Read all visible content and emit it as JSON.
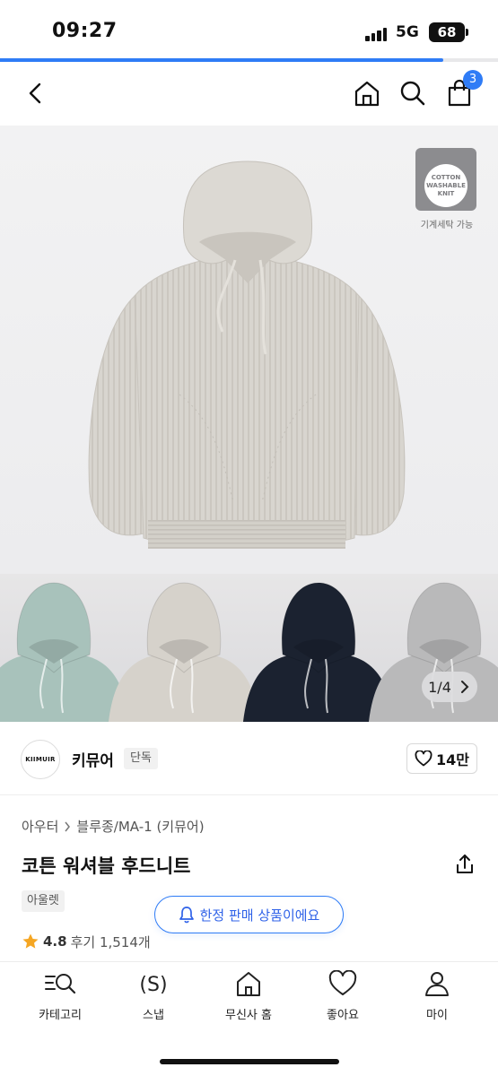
{
  "status_bar": {
    "time": "09:27",
    "network": "5G",
    "battery": "68"
  },
  "page_progress": 0.89,
  "top_nav": {
    "back_icon": "chevron-left-icon",
    "home_icon": "home-icon",
    "search_icon": "search-icon",
    "cart_icon": "cart-icon",
    "cart_count": "3"
  },
  "hero": {
    "wash_badge_text": [
      "COTTON",
      "WASHABLE",
      "KNIT"
    ],
    "wash_badge_caption": "기계세탁 가능"
  },
  "gallery": {
    "counter": "1/4",
    "thumb_colors": [
      "#a8c2bb",
      "#d6d2cb",
      "#1b2230",
      "#b9b9ba"
    ]
  },
  "brand": {
    "logo_text": "KIIMUIR",
    "name": "키뮤어",
    "tag": "단독",
    "like_count": "14만"
  },
  "product": {
    "breadcrumb": [
      "아우터",
      "블루종/MA-1 (키뮤어)"
    ],
    "title": "코튼 워셔블 후드니트",
    "outlet_tag": "아울렛",
    "notice": "한정 판매 상품이에요",
    "rating": "4.8",
    "review_text": "후기 1,514개"
  },
  "tab_bar": {
    "items": [
      {
        "label": "카테고리",
        "icon": "category-search-icon"
      },
      {
        "label": "스냅",
        "icon": "snap-icon"
      },
      {
        "label": "무신사 홈",
        "icon": "home-icon"
      },
      {
        "label": "좋아요",
        "icon": "heart-icon"
      },
      {
        "label": "마이",
        "icon": "person-icon"
      }
    ]
  },
  "colors": {
    "accent": "#2f7cf6",
    "hoodie_main": "#d8d5cf"
  }
}
